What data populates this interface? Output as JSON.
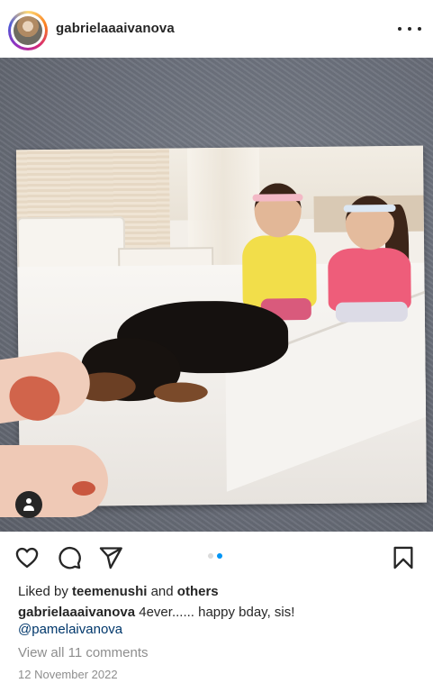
{
  "post": {
    "username": "gabrielaaaivanova",
    "avatar_icon": "profile-photo",
    "more_icon": "more-horizontal-icon",
    "carousel": {
      "slide_count": 2,
      "active_index": 1
    },
    "likes": {
      "prefix": "Liked by ",
      "user": "teemenushi",
      "middle": " and ",
      "others": "others"
    },
    "caption": {
      "username": "gabrielaaaivanova",
      "text": " 4ever...... happy bday, sis!",
      "mention": "@pamelaivanova"
    },
    "view_comments": "View all 11 comments",
    "date": "12 November 2022"
  },
  "icons": {
    "like": "heart-icon",
    "comment": "comment-icon",
    "share": "send-icon",
    "save": "bookmark-icon",
    "tag": "user-tag-icon"
  },
  "colors": {
    "text": "#262626",
    "mention": "#00376b",
    "muted": "#8e8e8e",
    "dot_active": "#0095f6",
    "dot_inactive": "#dbdbdb"
  }
}
